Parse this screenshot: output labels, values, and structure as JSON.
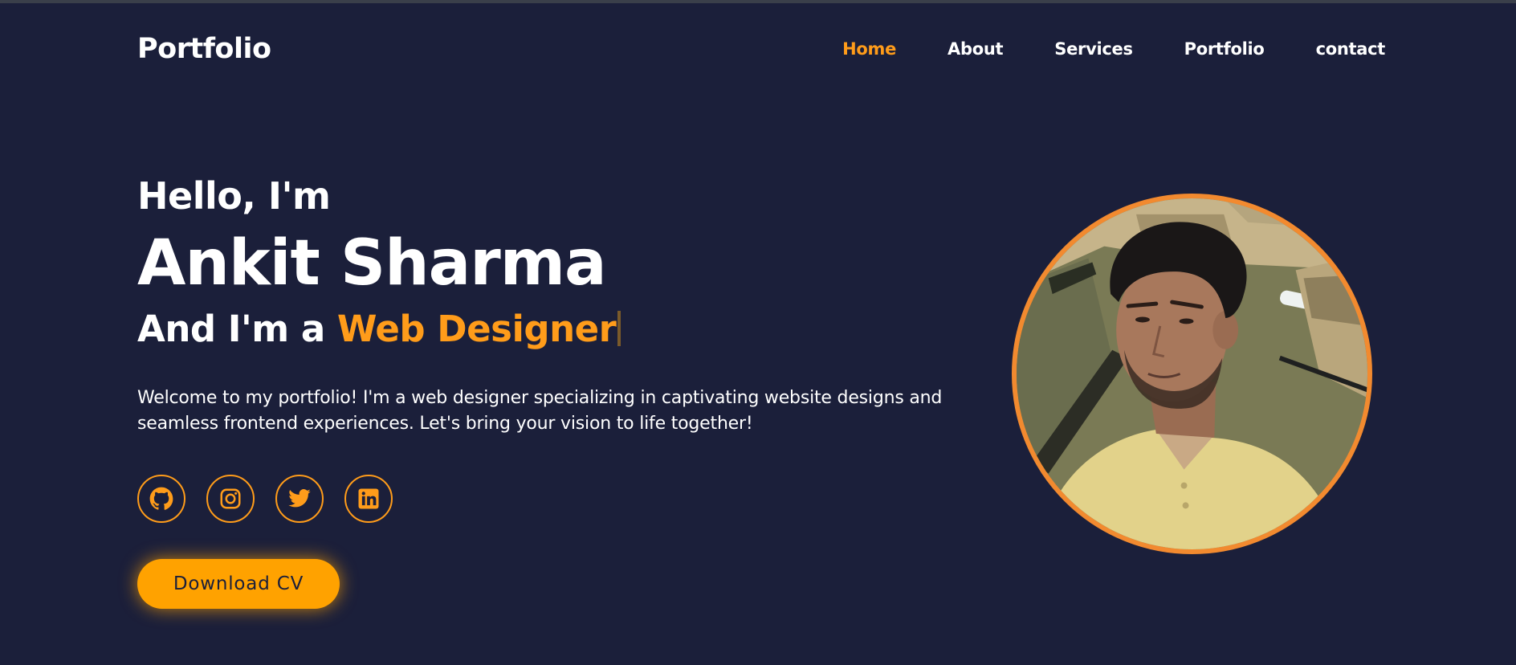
{
  "header": {
    "logo": "Portfolio",
    "nav": [
      {
        "label": "Home",
        "active": true
      },
      {
        "label": "About",
        "active": false
      },
      {
        "label": "Services",
        "active": false
      },
      {
        "label": "Portfolio",
        "active": false
      },
      {
        "label": "contact",
        "active": false
      }
    ]
  },
  "hero": {
    "greeting": "Hello, I'm",
    "name": "Ankit Sharma",
    "role_prefix": "And I'm a ",
    "role_highlight": "Web Designer",
    "intro": "Welcome to my portfolio! I'm a web designer specializing in captivating website designs and seamless frontend experiences. Let's bring your vision to life together!",
    "socials": [
      {
        "icon": "github-icon"
      },
      {
        "icon": "instagram-icon"
      },
      {
        "icon": "twitter-icon"
      },
      {
        "icon": "linkedin-icon"
      }
    ],
    "cv_button": "Download CV"
  },
  "colors": {
    "background": "#1b1f3a",
    "accent": "#ff9c1a",
    "button": "#ffa200",
    "photo_border": "#f28a2f"
  }
}
